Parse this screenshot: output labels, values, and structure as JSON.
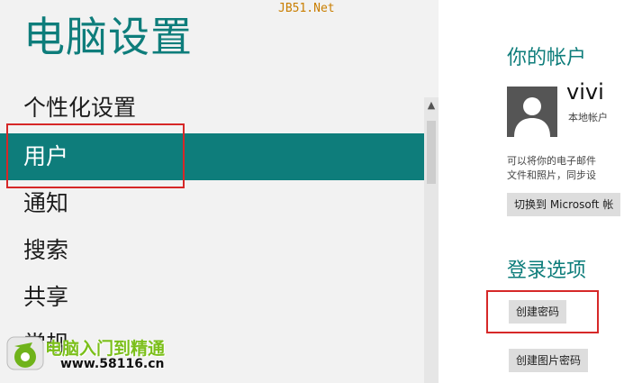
{
  "watermark": {
    "top_text": "JB51.Net",
    "site_title": "电脑入门到精通",
    "site_url": "www.58116.cn"
  },
  "sidebar": {
    "title": "电脑设置",
    "items": [
      {
        "label": "个性化设置",
        "selected": false
      },
      {
        "label": "用户",
        "selected": true
      },
      {
        "label": "通知",
        "selected": false
      },
      {
        "label": "搜索",
        "selected": false
      },
      {
        "label": "共享",
        "selected": false
      },
      {
        "label": "常规",
        "selected": false
      }
    ]
  },
  "account": {
    "title": "你的帐户",
    "user_name": "vivi",
    "account_type": "本地帐户",
    "description_line1": "可以将你的电子邮件",
    "description_line2": "文件和照片，同步设",
    "switch_button": "切换到 Microsoft 帐"
  },
  "login_options": {
    "title": "登录选项",
    "create_password_button": "创建密码",
    "create_picture_password_button": "创建图片密码"
  },
  "colors": {
    "accent": "#0e7d7b",
    "highlight_border": "#d62828",
    "pane_bg": "#f2f2f2"
  }
}
